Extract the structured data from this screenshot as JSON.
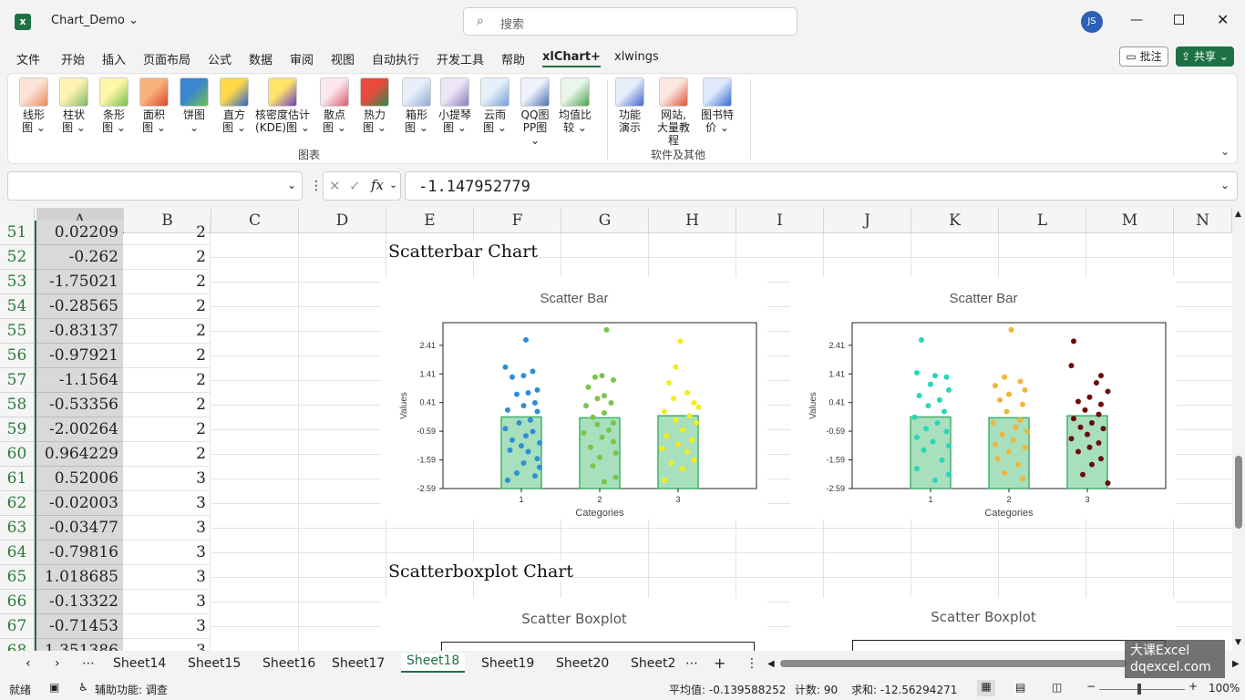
{
  "titlebar": {
    "filename": "Chart_Demo",
    "search_placeholder": "搜索",
    "avatar": "JS"
  },
  "menu": [
    "文件",
    "开始",
    "插入",
    "页面布局",
    "公式",
    "数据",
    "审阅",
    "视图",
    "自动执行",
    "开发工具",
    "帮助",
    "xlChart+",
    "xlwings"
  ],
  "actions": {
    "comment": "批注",
    "share": "共享"
  },
  "ribbon": {
    "group1_label": "图表",
    "group2_label": "软件及其他",
    "buttons": [
      {
        "l1": "线形",
        "l2": "图 ⌄",
        "c1": "#fbe3d6",
        "c2": "#e98a5d"
      },
      {
        "l1": "柱状",
        "l2": "图 ⌄",
        "c1": "#fff2b3",
        "c2": "#7bb661"
      },
      {
        "l1": "条形",
        "l2": "图 ⌄",
        "c1": "#fff6a8",
        "c2": "#6fbf4a"
      },
      {
        "l1": "面积",
        "l2": "图 ⌄",
        "c1": "#f7b27a",
        "c2": "#d94a2b"
      },
      {
        "l1": "饼图",
        "l2": "⌄",
        "c1": "#3a86d1",
        "c2": "#70c24a"
      },
      {
        "l1": "直方",
        "l2": "图 ⌄",
        "c1": "#ffd84a",
        "c2": "#2c63c9"
      },
      {
        "l1": "核密度估计",
        "l2": "(KDE)图 ⌄",
        "c1": "#ffe36b",
        "c2": "#6a3fc1"
      },
      {
        "l1": "散点",
        "l2": "图 ⌄",
        "c1": "#fbe7ef",
        "c2": "#d9586a"
      },
      {
        "l1": "热力",
        "l2": "图 ⌄",
        "c1": "#e84b3c",
        "c2": "#2f8a4a"
      },
      {
        "l1": "箱形",
        "l2": "图 ⌄",
        "c1": "#e9eef8",
        "c2": "#8aa9d8"
      },
      {
        "l1": "小提琴",
        "l2": "图 ⌄",
        "c1": "#ece6f6",
        "c2": "#8d7ac0"
      },
      {
        "l1": "云雨",
        "l2": "图 ⌄",
        "c1": "#e6f0fa",
        "c2": "#6f9fd6"
      },
      {
        "l1": "QQ图",
        "l2": "PP图 ⌄",
        "c1": "#eef2fb",
        "c2": "#4a6fb0"
      },
      {
        "l1": "均值比",
        "l2": "较 ⌄",
        "c1": "#eaf6ea",
        "c2": "#4aa24a"
      },
      {
        "l1": "功能",
        "l2": "演示",
        "c1": "#e6eefb",
        "c2": "#3f66c9"
      },
      {
        "l1": "网站,",
        "l2": "大量教程",
        "c1": "#fbe6e0",
        "c2": "#d9553a"
      },
      {
        "l1": "图书特",
        "l2": "价 ⌄",
        "c1": "#dfe9fb",
        "c2": "#2f6ad0"
      }
    ]
  },
  "formula": {
    "namebox": "",
    "fx": "fx",
    "value": "-1.147952779"
  },
  "columns": [
    "A",
    "B",
    "C",
    "D",
    "E",
    "F",
    "G",
    "H",
    "I",
    "J",
    "K",
    "L",
    "M",
    "N"
  ],
  "rows": [
    {
      "n": "51",
      "a": "0.02209",
      "b": "2"
    },
    {
      "n": "52",
      "a": "-0.262",
      "b": "2"
    },
    {
      "n": "53",
      "a": "-1.75021",
      "b": "2"
    },
    {
      "n": "54",
      "a": "-0.28565",
      "b": "2"
    },
    {
      "n": "55",
      "a": "-0.83137",
      "b": "2"
    },
    {
      "n": "56",
      "a": "-0.97921",
      "b": "2"
    },
    {
      "n": "57",
      "a": "-1.1564",
      "b": "2"
    },
    {
      "n": "58",
      "a": "-0.53356",
      "b": "2"
    },
    {
      "n": "59",
      "a": "-2.00264",
      "b": "2"
    },
    {
      "n": "60",
      "a": "0.964229",
      "b": "2"
    },
    {
      "n": "61",
      "a": "0.52006",
      "b": "3"
    },
    {
      "n": "62",
      "a": "-0.02003",
      "b": "3"
    },
    {
      "n": "63",
      "a": "-0.03477",
      "b": "3"
    },
    {
      "n": "64",
      "a": "-0.79816",
      "b": "3"
    },
    {
      "n": "65",
      "a": "1.018685",
      "b": "3"
    },
    {
      "n": "66",
      "a": "-0.13322",
      "b": "3"
    },
    {
      "n": "67",
      "a": "-0.71453",
      "b": "3"
    },
    {
      "n": "68",
      "a": "1.351386",
      "b": "3"
    }
  ],
  "sections": {
    "scatterbar": "Scatterbar Chart",
    "scatterboxplot": "Scatterboxplot Chart"
  },
  "boxplot_titles": [
    "Scatter Boxplot",
    "Scatter Boxplot"
  ],
  "chart_data": [
    {
      "type": "bar",
      "title": "Scatter Bar",
      "xlabel": "Categories",
      "ylabel": "Values",
      "categories": [
        "1",
        "2",
        "3"
      ],
      "yticks": [
        "2.41",
        "1.41",
        "0.41",
        "-0.59",
        "-1.59",
        "-2.59"
      ],
      "ylim": [
        -2.59,
        3.2
      ],
      "bar_values": [
        -0.09,
        -0.12,
        -0.05
      ],
      "bar_color": "#a8e0bd",
      "point_colors": [
        "#2f8ed6",
        "#7ac44a",
        "#f5ec1a"
      ],
      "points": [
        [
          [
            2.6,
            0.1
          ],
          [
            1.65,
            -0.35
          ],
          [
            1.5,
            0.25
          ],
          [
            1.35,
            0.05
          ],
          [
            1.3,
            -0.2
          ],
          [
            0.85,
            0.35
          ],
          [
            0.75,
            0.15
          ],
          [
            0.7,
            -0.1
          ],
          [
            0.4,
            0.3
          ],
          [
            0.3,
            0.05
          ],
          [
            0.15,
            -0.3
          ],
          [
            0.1,
            0.35
          ],
          [
            -0.2,
            0.2
          ],
          [
            -0.5,
            -0.35
          ],
          [
            -0.6,
            0.25
          ],
          [
            -0.75,
            0.1
          ],
          [
            -0.9,
            -0.2
          ],
          [
            -1.0,
            0.4
          ],
          [
            -1.1,
            0.0
          ],
          [
            -1.25,
            -0.25
          ],
          [
            -1.3,
            0.15
          ],
          [
            -1.55,
            0.35
          ],
          [
            -1.7,
            0.05
          ],
          [
            -1.85,
            0.4
          ],
          [
            -2.05,
            -0.1
          ],
          [
            -2.15,
            0.3
          ],
          [
            -2.3,
            -0.3
          ],
          [
            -0.3,
            -0.05
          ]
        ],
        [
          [
            2.95,
            0.15
          ],
          [
            1.35,
            0.05
          ],
          [
            1.3,
            -0.1
          ],
          [
            1.2,
            0.3
          ],
          [
            0.95,
            -0.25
          ],
          [
            0.65,
            0.1
          ],
          [
            0.55,
            -0.05
          ],
          [
            0.4,
            0.25
          ],
          [
            0.3,
            -0.3
          ],
          [
            0.05,
            0.1
          ],
          [
            -0.1,
            -0.15
          ],
          [
            -0.3,
            0.3
          ],
          [
            -0.35,
            -0.05
          ],
          [
            -0.55,
            0.2
          ],
          [
            -0.65,
            -0.35
          ],
          [
            -0.8,
            0.05
          ],
          [
            -0.95,
            0.3
          ],
          [
            -1.15,
            -0.2
          ],
          [
            -1.35,
            0.35
          ],
          [
            -1.5,
            0.0
          ],
          [
            -1.8,
            -0.15
          ],
          [
            -2.2,
            0.35
          ],
          [
            -2.35,
            0.1
          ]
        ],
        [
          [
            2.55,
            0.05
          ],
          [
            1.65,
            -0.05
          ],
          [
            1.1,
            -0.2
          ],
          [
            0.75,
            0.2
          ],
          [
            0.55,
            -0.1
          ],
          [
            0.4,
            0.35
          ],
          [
            0.25,
            0.45
          ],
          [
            0.1,
            -0.3
          ],
          [
            -0.05,
            0.25
          ],
          [
            -0.2,
            -0.05
          ],
          [
            -0.3,
            0.4
          ],
          [
            -0.55,
            0.1
          ],
          [
            -0.75,
            -0.25
          ],
          [
            -0.9,
            0.3
          ],
          [
            -1.05,
            0.0
          ],
          [
            -1.2,
            -0.35
          ],
          [
            -1.3,
            0.2
          ],
          [
            -1.6,
            0.35
          ],
          [
            -1.7,
            -0.15
          ],
          [
            -1.9,
            0.1
          ],
          [
            -2.3,
            -0.3
          ]
        ]
      ]
    },
    {
      "type": "bar",
      "title": "Scatter Bar",
      "xlabel": "Categories",
      "ylabel": "Values",
      "categories": [
        "1",
        "2",
        "3"
      ],
      "yticks": [
        "2.41",
        "1.41",
        "0.41",
        "-0.59",
        "-1.59",
        "-2.59"
      ],
      "ylim": [
        -2.59,
        3.2
      ],
      "bar_values": [
        -0.09,
        -0.12,
        -0.05
      ],
      "bar_color": "#a8e0bd",
      "point_colors": [
        "#2ad6b8",
        "#f0b43c",
        "#6b0b0b"
      ],
      "points": [
        [
          [
            2.6,
            -0.2
          ],
          [
            1.45,
            -0.3
          ],
          [
            1.35,
            0.1
          ],
          [
            1.3,
            0.35
          ],
          [
            1.05,
            0.0
          ],
          [
            0.85,
            0.4
          ],
          [
            0.65,
            -0.25
          ],
          [
            0.5,
            0.2
          ],
          [
            0.3,
            -0.05
          ],
          [
            0.1,
            0.3
          ],
          [
            -0.1,
            -0.35
          ],
          [
            -0.3,
            0.15
          ],
          [
            -0.5,
            -0.1
          ],
          [
            -0.6,
            0.35
          ],
          [
            -0.8,
            -0.3
          ],
          [
            -0.95,
            0.05
          ],
          [
            -1.1,
            0.4
          ],
          [
            -1.25,
            -0.15
          ],
          [
            -1.6,
            0.25
          ],
          [
            -1.9,
            -0.3
          ],
          [
            -2.1,
            0.4
          ],
          [
            -2.3,
            0.1
          ]
        ],
        [
          [
            2.95,
            0.05
          ],
          [
            1.3,
            -0.1
          ],
          [
            1.15,
            0.25
          ],
          [
            1.0,
            -0.3
          ],
          [
            0.85,
            0.35
          ],
          [
            0.7,
            0.0
          ],
          [
            0.5,
            -0.2
          ],
          [
            0.35,
            0.3
          ],
          [
            0.1,
            -0.05
          ],
          [
            -0.2,
            0.25
          ],
          [
            -0.3,
            -0.35
          ],
          [
            -0.45,
            0.15
          ],
          [
            -0.6,
            0.4
          ],
          [
            -0.7,
            -0.15
          ],
          [
            -0.9,
            0.1
          ],
          [
            -1.05,
            -0.3
          ],
          [
            -1.15,
            0.35
          ],
          [
            -1.3,
            0.0
          ],
          [
            -1.55,
            -0.25
          ],
          [
            -1.75,
            0.2
          ],
          [
            -2.05,
            -0.1
          ],
          [
            -2.25,
            0.3
          ]
        ],
        [
          [
            2.55,
            -0.3
          ],
          [
            1.7,
            -0.35
          ],
          [
            1.35,
            0.3
          ],
          [
            1.1,
            0.2
          ],
          [
            0.8,
            0.45
          ],
          [
            0.6,
            0.05
          ],
          [
            0.45,
            -0.2
          ],
          [
            0.35,
            0.3
          ],
          [
            0.15,
            -0.05
          ],
          [
            0.0,
            0.25
          ],
          [
            -0.15,
            -0.3
          ],
          [
            -0.3,
            0.1
          ],
          [
            -0.45,
            -0.15
          ],
          [
            -0.5,
            0.35
          ],
          [
            -0.7,
            0.0
          ],
          [
            -0.85,
            -0.35
          ],
          [
            -1.0,
            0.25
          ],
          [
            -1.15,
            0.05
          ],
          [
            -1.3,
            -0.2
          ],
          [
            -1.55,
            0.3
          ],
          [
            -1.75,
            0.1
          ],
          [
            -2.1,
            -0.1
          ],
          [
            -2.4,
            0.45
          ]
        ]
      ]
    }
  ],
  "sheets": [
    "Sheet14",
    "Sheet15",
    "Sheet16",
    "Sheet17",
    "Sheet18",
    "Sheet19",
    "Sheet20",
    "Sheet2"
  ],
  "active_sheet": "Sheet18",
  "status": {
    "ready": "就绪",
    "accessibility": "辅助功能: 调查",
    "average": "平均值: -0.139588252",
    "count": "计数: 90",
    "sum": "求和: -12.56294271",
    "zoom": "100%"
  },
  "watermark": {
    "line1": "大课Excel",
    "line2": "dqexcel.com"
  }
}
